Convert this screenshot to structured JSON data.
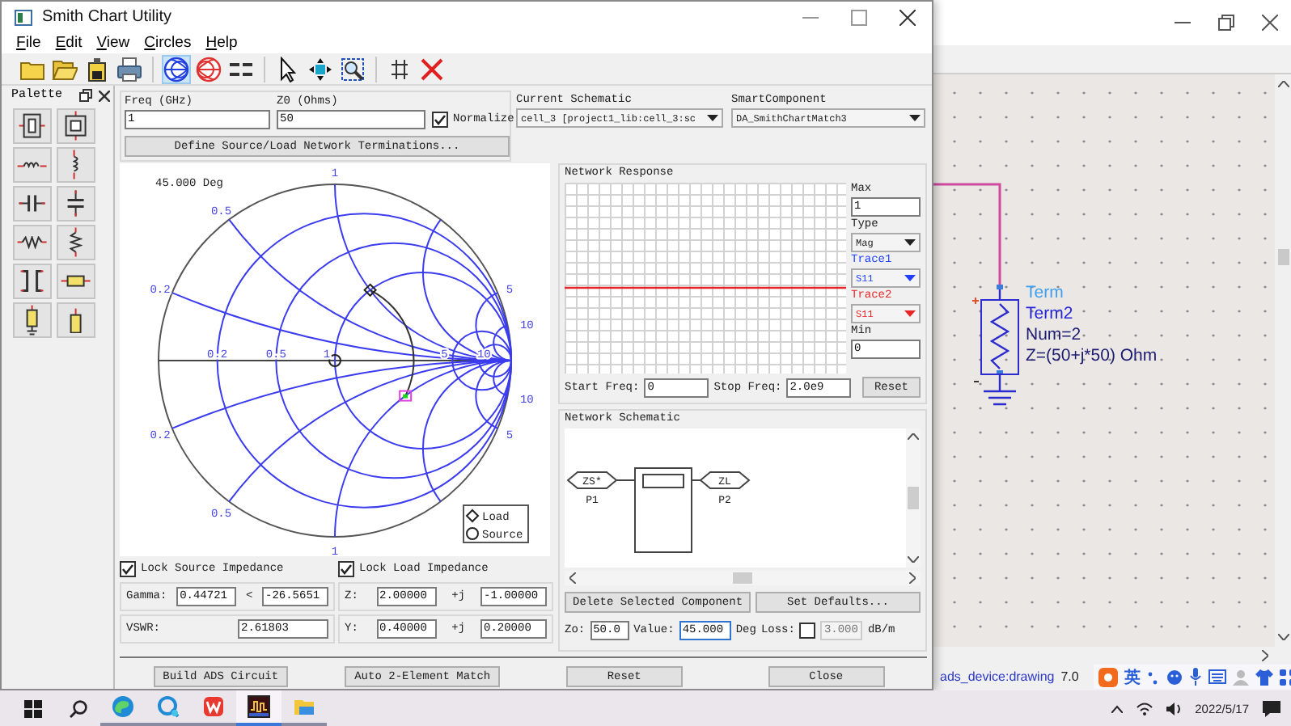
{
  "ads_window": {
    "status": [
      "ads_device:drawing",
      "7.0"
    ],
    "term_labels": [
      {
        "kind": "type",
        "text": "Term"
      },
      {
        "kind": "name",
        "text": "Term2"
      },
      {
        "kind": "param",
        "text": "Num=2"
      },
      {
        "kind": "param",
        "text": "Z=(50+j*50) Ohm"
      }
    ],
    "ime": {
      "label": "英"
    }
  },
  "smith_window": {
    "title": "Smith Chart Utility",
    "menu": [
      "File",
      "Edit",
      "View",
      "Circles",
      "Help"
    ],
    "toolbar": [
      {
        "kind": "new",
        "selected": false
      },
      {
        "kind": "open",
        "selected": false
      },
      {
        "kind": "save",
        "selected": false
      },
      {
        "kind": "print",
        "selected": false
      },
      {
        "kind": "smith-z",
        "selected": true
      },
      {
        "kind": "smith-y",
        "selected": false
      },
      {
        "kind": "gmin",
        "selected": false
      },
      {
        "kind": "select",
        "selected": false
      },
      {
        "kind": "move",
        "selected": false
      },
      {
        "kind": "zoom",
        "selected": false
      },
      {
        "kind": "grid",
        "selected": false
      },
      {
        "kind": "delete",
        "selected": false
      }
    ],
    "palette": {
      "title": "Palette",
      "items": [
        {
          "kind": "series-element"
        },
        {
          "kind": "shunt-element"
        },
        {
          "kind": "series-inductor"
        },
        {
          "kind": "shunt-inductor"
        },
        {
          "kind": "series-capacitor"
        },
        {
          "kind": "shunt-capacitor"
        },
        {
          "kind": "series-resistor"
        },
        {
          "kind": "shunt-resistor"
        },
        {
          "kind": "coupled-lines"
        },
        {
          "kind": "series-line"
        },
        {
          "kind": "shunt-stub"
        },
        {
          "kind": "open-stub"
        }
      ]
    },
    "freq": {
      "label": "Freq (GHz)",
      "value": "1"
    },
    "z0": {
      "label": "Z0 (Ohms)",
      "value": "50"
    },
    "normalize": {
      "label": "Normalize",
      "checked": true
    },
    "current_schematic": {
      "label": "Current Schematic",
      "value": "cell_3 [project1_lib:cell_3:sc"
    },
    "smart_component": {
      "label": "SmartComponent",
      "value": "DA_SmithChartMatch3"
    },
    "define_button": "Define Source/Load Network Terminations...",
    "smith_chart": {
      "angle_label": "45.000 Deg",
      "resistance_labels": [
        "0.2",
        "0.5",
        "1",
        "5",
        "10"
      ],
      "upper_reactance_labels": [
        "1",
        "0.5",
        "0.2",
        "5",
        "10"
      ],
      "lower_reactance_labels": [
        "10",
        "0.2",
        "5",
        "0.5",
        "1"
      ],
      "legend": [
        {
          "kind": "load",
          "label": "Load"
        },
        {
          "kind": "source",
          "label": "Source"
        }
      ]
    },
    "network_response": {
      "title": "Network Response",
      "max": {
        "label": "Max",
        "value": "1"
      },
      "type": {
        "label": "Type",
        "value": "Mag"
      },
      "traces": [
        {
          "label": "Trace1",
          "value": "S11",
          "color": "#1f3fff"
        },
        {
          "label": "Trace2",
          "value": "S11",
          "color": "#e8262a"
        }
      ],
      "min": {
        "label": "Min",
        "value": "0"
      },
      "start": {
        "label": "Start Freq:",
        "value": "0"
      },
      "stop": {
        "label": "Stop Freq:",
        "value": "2.0e9"
      },
      "reset": "Reset"
    },
    "network_schematic": {
      "title": "Network Schematic",
      "ports": [
        {
          "symbol": "ZS*",
          "label": "P1"
        },
        {
          "symbol": "ZL",
          "label": "P2"
        }
      ],
      "buttons": [
        "Delete Selected Component",
        "Set Defaults..."
      ],
      "zo": {
        "label": "Zo:",
        "value": "50.0"
      },
      "value": {
        "label": "Value:",
        "value": "45.000",
        "unit": "Deg"
      },
      "loss": {
        "label": "Loss:",
        "checked": false,
        "value": "3.000",
        "unit": "dB/m",
        "disabled": true
      }
    },
    "source": {
      "label": "Lock Source Impedance",
      "checked": true,
      "gamma": {
        "label": "Gamma:",
        "magnitude": "0.44721",
        "angle_sign": "<",
        "angle": "-26.5651"
      },
      "vswr": {
        "label": "VSWR:",
        "value": "2.61803"
      }
    },
    "load": {
      "label": "Lock Load Impedance",
      "checked": true,
      "rows": [
        {
          "label": "Z:",
          "real": "2.00000",
          "j": "+j",
          "imag": "-1.00000"
        },
        {
          "label": "Y:",
          "real": "0.40000",
          "j": "+j",
          "imag": "0.20000"
        }
      ]
    },
    "buttons": [
      "Build ADS Circuit",
      "Auto 2-Element Match",
      "Reset",
      "Close"
    ]
  },
  "taskbar": {
    "apps": [
      {
        "kind": "edge",
        "selected": false
      },
      {
        "kind": "chat",
        "selected": false
      },
      {
        "kind": "wps",
        "selected": false
      },
      {
        "kind": "ads",
        "selected": true
      },
      {
        "kind": "explorer",
        "selected": false
      }
    ],
    "date": "2022/5/17"
  }
}
